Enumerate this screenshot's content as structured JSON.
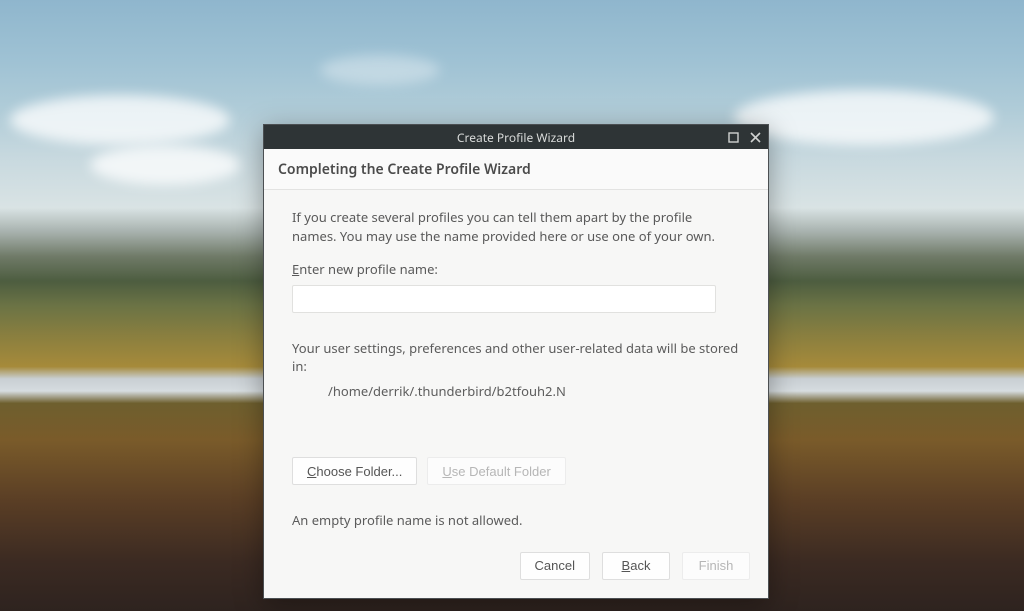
{
  "window": {
    "title": "Create Profile Wizard"
  },
  "header": {
    "heading": "Completing the Create Profile Wizard"
  },
  "body": {
    "intro": "If you create several profiles you can tell them apart by the profile names. You may use the name provided here or use one of your own.",
    "profile_name_label_pre": "E",
    "profile_name_label_rest": "nter new profile name:",
    "profile_name_value": "",
    "storage_note": "Your user settings, preferences and other user-related data will be stored in:",
    "storage_path": "/home/derrik/.thunderbird/b2tfouh2.N",
    "error": "An empty profile name is not allowed."
  },
  "buttons": {
    "choose_folder_pre": "C",
    "choose_folder_rest": "hoose Folder...",
    "use_default_pre": "U",
    "use_default_rest": "se Default Folder",
    "cancel": "Cancel",
    "back_pre": "B",
    "back_rest": "ack",
    "finish": "Finish"
  }
}
